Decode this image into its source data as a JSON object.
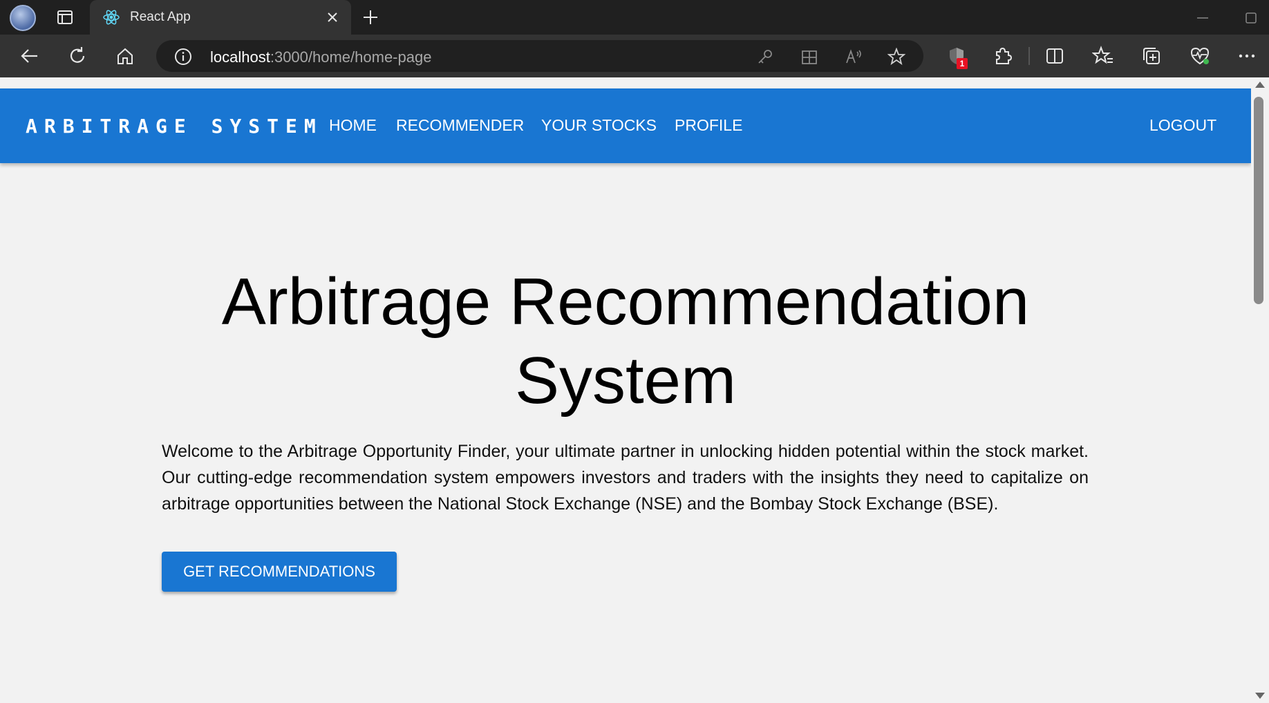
{
  "browser": {
    "tab_title": "React App",
    "url_host": "localhost",
    "url_path": ":3000/home/home-page",
    "notification_count": "1",
    "icons": [
      "profile-avatar",
      "tab-actions-icon",
      "react-logo-icon",
      "close-icon",
      "plus-icon",
      "back-arrow-icon",
      "refresh-icon",
      "home-icon",
      "info-icon",
      "key-icon",
      "app-grid-icon",
      "read-aloud-icon",
      "star-icon",
      "shield-icon",
      "extensions-icon",
      "split-screen-icon",
      "favorites-icon",
      "collections-icon",
      "heart-pulse-icon",
      "more-icon"
    ]
  },
  "appbar": {
    "brand": "ARBITRAGE SYSTEM",
    "nav": [
      "HOME",
      "RECOMMENDER",
      "YOUR STOCKS",
      "PROFILE"
    ],
    "logout": "LOGOUT",
    "color": "#1976d2"
  },
  "hero": {
    "title_line1": "Arbitrage Recommendation",
    "title_line2": "System",
    "intro": "Welcome to the Arbitrage Opportunity Finder, your ultimate partner in unlocking hidden potential within the stock market. Our cutting-edge recommendation system empowers investors and traders with the insights they need to capitalize on arbitrage opportunities between the National Stock Exchange (NSE) and the Bombay Stock Exchange (BSE).",
    "cta_label": "GET RECOMMENDATIONS"
  }
}
